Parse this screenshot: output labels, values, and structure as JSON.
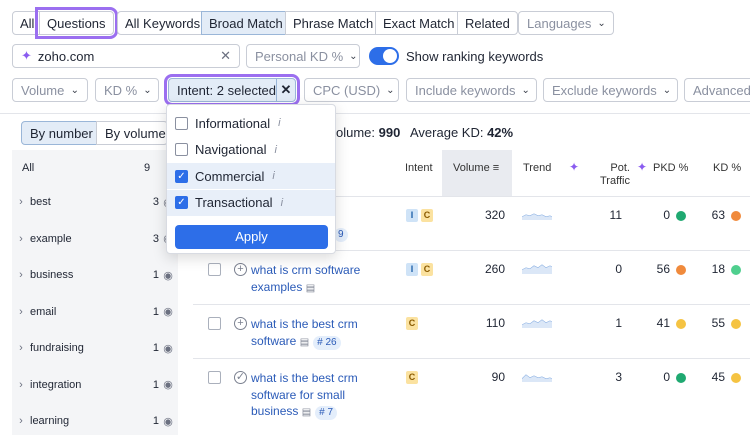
{
  "top_tabs": [
    {
      "label": "All"
    },
    {
      "label": "Questions"
    },
    {
      "label": "All Keywords"
    },
    {
      "label": "Broad Match"
    },
    {
      "label": "Phrase Match"
    },
    {
      "label": "Exact Match"
    },
    {
      "label": "Related"
    }
  ],
  "languages_label": "Languages",
  "search": {
    "value": "zoho.com"
  },
  "personal_kd_label": "Personal KD %",
  "show_ranking_label": "Show ranking keywords",
  "filters": {
    "volume": "Volume",
    "kd": "KD %",
    "intent": "Intent: 2 selected",
    "cpc": "CPC (USD)",
    "include": "Include keywords",
    "exclude": "Exclude keywords",
    "advanced": "Advanced"
  },
  "group_by": {
    "by_number": "By number",
    "by_volume": "By volume"
  },
  "summary": {
    "volume_label": "olume:",
    "volume_value": "990",
    "kd_label": "Average KD:",
    "kd_value": "42%"
  },
  "left_panel": {
    "header_label": "All",
    "header_count": "9",
    "items": [
      {
        "label": "best",
        "count": "3"
      },
      {
        "label": "example",
        "count": "3"
      },
      {
        "label": "business",
        "count": "1"
      },
      {
        "label": "email",
        "count": "1"
      },
      {
        "label": "fundraising",
        "count": "1"
      },
      {
        "label": "integration",
        "count": "1"
      },
      {
        "label": "learning",
        "count": "1"
      }
    ]
  },
  "table": {
    "headers": {
      "intent": "Intent",
      "volume": "Volume",
      "trend": "Trend",
      "pot_traffic_1": "Pot.",
      "pot_traffic_2": "Traffic",
      "pkd": "PKD %",
      "kd": "KD %"
    },
    "rows": [
      {
        "keyword_line1": "",
        "keyword_line2": "",
        "keyword_line3": "",
        "badge": "9",
        "intents": [
          "I",
          "C"
        ],
        "volume": "320",
        "traffic": "11",
        "pkd": "0",
        "kd": "63",
        "pkd_color": "#1fa971",
        "kd_color": "#f08a3c"
      },
      {
        "keyword_line1": "what is crm software",
        "keyword_line2": "examples",
        "keyword_line3": "",
        "badge": "",
        "intents": [
          "I",
          "C"
        ],
        "volume": "260",
        "traffic": "0",
        "pkd": "56",
        "kd": "18",
        "pkd_color": "#f08a3c",
        "kd_color": "#4fcf8e"
      },
      {
        "keyword_line1": "what is the best crm",
        "keyword_line2": "software",
        "keyword_line3": "",
        "badge": "# 26",
        "intents": [
          "C"
        ],
        "volume": "110",
        "traffic": "1",
        "pkd": "41",
        "kd": "55",
        "pkd_color": "#f5c342",
        "kd_color": "#f5c342"
      },
      {
        "keyword_line1": "what is the best crm",
        "keyword_line2": "software for small",
        "keyword_line3": "business",
        "badge": "# 7",
        "intents": [
          "C"
        ],
        "volume": "90",
        "traffic": "3",
        "pkd": "0",
        "kd": "45",
        "pkd_color": "#1fa971",
        "kd_color": "#f5c342"
      }
    ]
  },
  "intent_dropdown": {
    "options": [
      {
        "label": "Informational",
        "checked": false
      },
      {
        "label": "Navigational",
        "checked": false
      },
      {
        "label": "Commercial",
        "checked": true
      },
      {
        "label": "Transactional",
        "checked": true
      }
    ],
    "apply_label": "Apply"
  },
  "icons": {
    "info": "info-icon",
    "check": "check-icon",
    "sparkle": "sparkle-icon",
    "eye": "eye-icon",
    "close": "close-icon",
    "sort": "sort-icon",
    "chevron": "chevron-down-icon"
  },
  "colors": {
    "accent": "#2d6ee8",
    "highlight": "#9b6ff0",
    "link": "#2b5bb8"
  }
}
